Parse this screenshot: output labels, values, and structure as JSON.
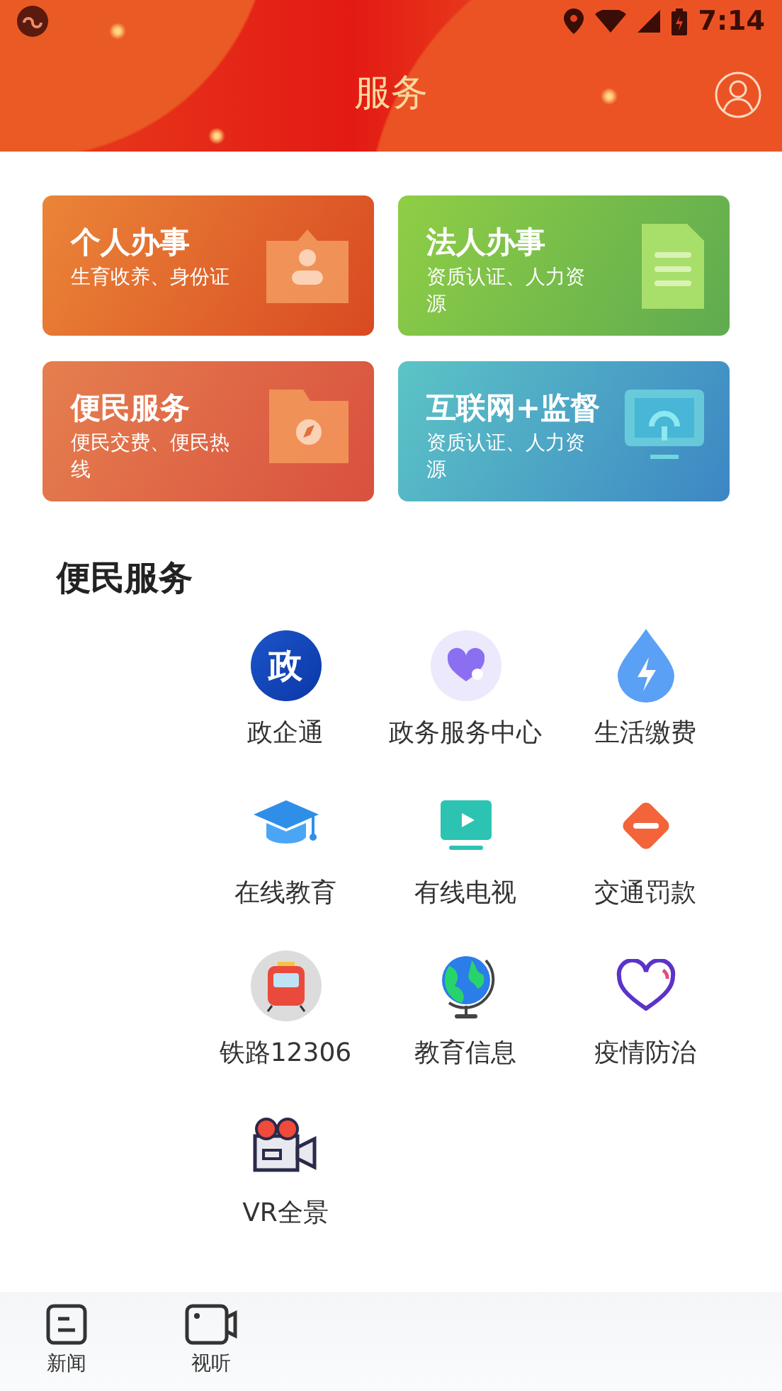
{
  "status_bar": {
    "time": "7:14"
  },
  "header": {
    "title": "服务"
  },
  "cards": [
    {
      "title": "个人办事",
      "subtitle": "生育收养、身份证",
      "kind": "person"
    },
    {
      "title": "法人办事",
      "subtitle": "资质认证、人力资源",
      "kind": "document"
    },
    {
      "title": "便民服务",
      "subtitle": "便民交费、便民热线",
      "kind": "folder"
    },
    {
      "title": "互联网+监督",
      "subtitle": "资质认证、人力资源",
      "kind": "monitor"
    }
  ],
  "section": {
    "title": "便民服务",
    "items": [
      {
        "label": "政企通",
        "kind": "badge",
        "badge": "政"
      },
      {
        "label": "政务服务中心",
        "kind": "heart-circle"
      },
      {
        "label": "生活缴费",
        "kind": "drop"
      },
      {
        "label": "在线教育",
        "kind": "cap"
      },
      {
        "label": "有线电视",
        "kind": "tv"
      },
      {
        "label": "交通罚款",
        "kind": "diamond"
      },
      {
        "label": "铁路12306",
        "kind": "train"
      },
      {
        "label": "教育信息",
        "kind": "globe"
      },
      {
        "label": "疫情防治",
        "kind": "heart"
      },
      {
        "label": "VR全景",
        "kind": "camera"
      }
    ]
  },
  "bottom_nav": [
    {
      "label": "新闻",
      "kind": "news",
      "selected": false
    },
    {
      "label": "视听",
      "kind": "video",
      "selected": false
    }
  ]
}
